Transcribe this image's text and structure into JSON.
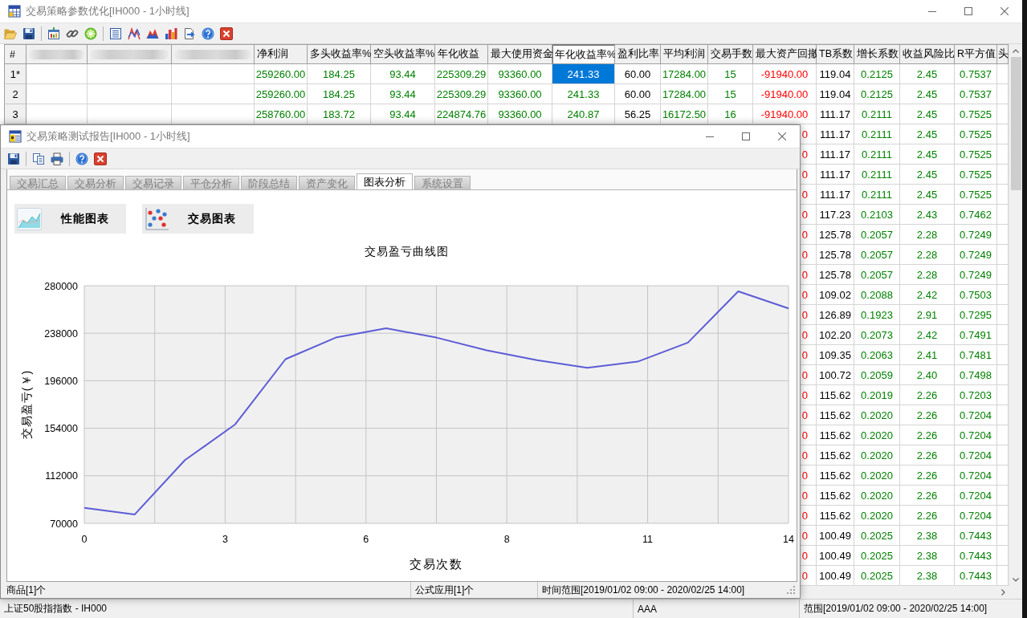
{
  "main_window": {
    "title": "交易策略参数优化[IH000 - 1小时线]",
    "table": {
      "row_header_label": "#",
      "columns": [
        {
          "redacted": true,
          "selected": false
        },
        {
          "redacted": true,
          "selected": false
        },
        {
          "redacted": true,
          "selected": false
        },
        {
          "label": "净利润",
          "color": "#008000",
          "selected": false
        },
        {
          "label": "多头收益率%",
          "color": "#008000",
          "selected": false
        },
        {
          "label": "空头收益率%",
          "color": "#008000",
          "selected": false
        },
        {
          "label": "年化收益",
          "color": "#008000",
          "selected": false
        },
        {
          "label": "最大使用资金",
          "color": "#008000",
          "selected": false
        },
        {
          "label": "年化收益率%",
          "color": "#008000",
          "selected": true
        },
        {
          "label": "盈利比率",
          "color": "#000000",
          "selected": false
        },
        {
          "label": "平均利润",
          "color": "#008000",
          "selected": false
        },
        {
          "label": "交易手数",
          "color": "#008000",
          "selected": false
        },
        {
          "label": "最大资产回撤",
          "color": "#ff0000",
          "selected": false
        },
        {
          "label": "TB系数",
          "color": "#000000",
          "selected": false
        },
        {
          "label": "增长系数",
          "color": "#008000",
          "selected": false
        },
        {
          "label": "收益风险比",
          "color": "#008000",
          "selected": false
        },
        {
          "label": "R平方值",
          "color": "#008000",
          "selected": false
        },
        {
          "label": "头",
          "selected": false
        }
      ],
      "rows": [
        {
          "header": "1*",
          "cells": [
            "",
            "",
            "",
            {
              "text": "259260.00",
              "selected": false
            },
            {
              "text": "184.25",
              "selected": false
            },
            {
              "text": "93.44",
              "selected": false
            },
            {
              "text": "225309.29",
              "selected": false
            },
            {
              "text": "93360.00",
              "selected": false
            },
            {
              "text": "241.33",
              "selected": true
            },
            {
              "text": "60.00",
              "selected": false
            },
            {
              "text": "17284.00",
              "selected": false
            },
            {
              "text": "15",
              "selected": false
            },
            {
              "text": "-91940.00",
              "selected": false
            },
            {
              "text": "119.04",
              "selected": false
            },
            {
              "text": "0.2125",
              "selected": false
            },
            {
              "text": "2.45",
              "selected": false
            },
            {
              "text": "0.7537",
              "selected": false
            }
          ]
        },
        {
          "header": "2",
          "cells": [
            "",
            "",
            "",
            {
              "text": "259260.00",
              "selected": false
            },
            {
              "text": "184.25",
              "selected": false
            },
            {
              "text": "93.44",
              "selected": false
            },
            {
              "text": "225309.29",
              "selected": false
            },
            {
              "text": "93360.00",
              "selected": false
            },
            {
              "text": "241.33",
              "selected": false
            },
            {
              "text": "60.00",
              "selected": false
            },
            {
              "text": "17284.00",
              "selected": false
            },
            {
              "text": "15",
              "selected": false
            },
            {
              "text": "-91940.00",
              "selected": false
            },
            {
              "text": "119.04",
              "selected": false
            },
            {
              "text": "0.2125",
              "selected": false
            },
            {
              "text": "2.45",
              "selected": false
            },
            {
              "text": "0.7537",
              "selected": false
            }
          ]
        },
        {
          "header": "3",
          "cells": [
            "",
            "",
            "",
            {
              "text": "258760.00",
              "selected": false
            },
            {
              "text": "183.72",
              "selected": false
            },
            {
              "text": "93.44",
              "selected": false
            },
            {
              "text": "224874.76",
              "selected": false
            },
            {
              "text": "93360.00",
              "selected": false
            },
            {
              "text": "240.87",
              "selected": false
            },
            {
              "text": "56.25",
              "selected": false
            },
            {
              "text": "16172.50",
              "selected": false
            },
            {
              "text": "16",
              "selected": false
            },
            {
              "text": "-91940.00",
              "selected": false
            },
            {
              "text": "111.17",
              "selected": false
            },
            {
              "text": "0.2111",
              "selected": false
            },
            {
              "text": "2.45",
              "selected": false
            },
            {
              "text": "0.7525",
              "selected": false
            }
          ]
        },
        {
          "cells": [
            "",
            "",
            "",
            "",
            "",
            "",
            "",
            "",
            "",
            "",
            "",
            "",
            {
              "text": "0",
              "selected": false
            },
            {
              "text": "111.17",
              "selected": false
            },
            {
              "text": "0.2111",
              "selected": false
            },
            {
              "text": "2.45",
              "selected": false
            },
            {
              "text": "0.7525",
              "selected": false
            }
          ]
        },
        {
          "cells": [
            "",
            "",
            "",
            "",
            "",
            "",
            "",
            "",
            "",
            "",
            "",
            "",
            {
              "text": "0",
              "selected": false
            },
            {
              "text": "111.17",
              "selected": false
            },
            {
              "text": "0.2111",
              "selected": false
            },
            {
              "text": "2.45",
              "selected": false
            },
            {
              "text": "0.7525",
              "selected": false
            }
          ]
        },
        {
          "cells": [
            "",
            "",
            "",
            "",
            "",
            "",
            "",
            "",
            "",
            "",
            "",
            "",
            {
              "text": "0",
              "selected": false
            },
            {
              "text": "111.17",
              "selected": false
            },
            {
              "text": "0.2111",
              "selected": false
            },
            {
              "text": "2.45",
              "selected": false
            },
            {
              "text": "0.7525",
              "selected": false
            }
          ]
        },
        {
          "cells": [
            "",
            "",
            "",
            "",
            "",
            "",
            "",
            "",
            "",
            "",
            "",
            "",
            {
              "text": "0",
              "selected": false
            },
            {
              "text": "111.17",
              "selected": false
            },
            {
              "text": "0.2111",
              "selected": false
            },
            {
              "text": "2.45",
              "selected": false
            },
            {
              "text": "0.7525",
              "selected": false
            }
          ]
        },
        {
          "cells": [
            "",
            "",
            "",
            "",
            "",
            "",
            "",
            "",
            "",
            "",
            "",
            "",
            {
              "text": "0",
              "selected": false
            },
            {
              "text": "117.23",
              "selected": false
            },
            {
              "text": "0.2103",
              "selected": false
            },
            {
              "text": "2.43",
              "selected": false
            },
            {
              "text": "0.7462",
              "selected": false
            }
          ]
        },
        {
          "cells": [
            "",
            "",
            "",
            "",
            "",
            "",
            "",
            "",
            "",
            "",
            "",
            "",
            {
              "text": "0",
              "selected": false
            },
            {
              "text": "125.78",
              "selected": false
            },
            {
              "text": "0.2057",
              "selected": false
            },
            {
              "text": "2.28",
              "selected": false
            },
            {
              "text": "0.7249",
              "selected": false
            }
          ]
        },
        {
          "cells": [
            "",
            "",
            "",
            "",
            "",
            "",
            "",
            "",
            "",
            "",
            "",
            "",
            {
              "text": "0",
              "selected": false
            },
            {
              "text": "125.78",
              "selected": false
            },
            {
              "text": "0.2057",
              "selected": false
            },
            {
              "text": "2.28",
              "selected": false
            },
            {
              "text": "0.7249",
              "selected": false
            }
          ]
        },
        {
          "cells": [
            "",
            "",
            "",
            "",
            "",
            "",
            "",
            "",
            "",
            "",
            "",
            "",
            {
              "text": "0",
              "selected": false
            },
            {
              "text": "125.78",
              "selected": false
            },
            {
              "text": "0.2057",
              "selected": false
            },
            {
              "text": "2.28",
              "selected": false
            },
            {
              "text": "0.7249",
              "selected": false
            }
          ]
        },
        {
          "cells": [
            "",
            "",
            "",
            "",
            "",
            "",
            "",
            "",
            "",
            "",
            "",
            "",
            {
              "text": "0",
              "selected": false
            },
            {
              "text": "109.02",
              "selected": false
            },
            {
              "text": "0.2088",
              "selected": false
            },
            {
              "text": "2.42",
              "selected": false
            },
            {
              "text": "0.7503",
              "selected": false
            }
          ]
        },
        {
          "cells": [
            "",
            "",
            "",
            "",
            "",
            "",
            "",
            "",
            "",
            "",
            "",
            "",
            {
              "text": "0",
              "selected": false
            },
            {
              "text": "126.89",
              "selected": false
            },
            {
              "text": "0.1923",
              "selected": false
            },
            {
              "text": "2.91",
              "selected": false
            },
            {
              "text": "0.7295",
              "selected": false
            }
          ]
        },
        {
          "cells": [
            "",
            "",
            "",
            "",
            "",
            "",
            "",
            "",
            "",
            "",
            "",
            "",
            {
              "text": "0",
              "selected": false
            },
            {
              "text": "102.20",
              "selected": false
            },
            {
              "text": "0.2073",
              "selected": false
            },
            {
              "text": "2.42",
              "selected": false
            },
            {
              "text": "0.7491",
              "selected": false
            }
          ]
        },
        {
          "cells": [
            "",
            "",
            "",
            "",
            "",
            "",
            "",
            "",
            "",
            "",
            "",
            "",
            {
              "text": "0",
              "selected": false
            },
            {
              "text": "109.35",
              "selected": false
            },
            {
              "text": "0.2063",
              "selected": false
            },
            {
              "text": "2.41",
              "selected": false
            },
            {
              "text": "0.7481",
              "selected": false
            }
          ]
        },
        {
          "cells": [
            "",
            "",
            "",
            "",
            "",
            "",
            "",
            "",
            "",
            "",
            "",
            "",
            {
              "text": "0",
              "selected": false
            },
            {
              "text": "100.72",
              "selected": false
            },
            {
              "text": "0.2059",
              "selected": false
            },
            {
              "text": "2.40",
              "selected": false
            },
            {
              "text": "0.7498",
              "selected": false
            }
          ]
        },
        {
          "cells": [
            "",
            "",
            "",
            "",
            "",
            "",
            "",
            "",
            "",
            "",
            "",
            "",
            {
              "text": "0",
              "selected": false
            },
            {
              "text": "115.62",
              "selected": false
            },
            {
              "text": "0.2019",
              "selected": false
            },
            {
              "text": "2.26",
              "selected": false
            },
            {
              "text": "0.7203",
              "selected": false
            }
          ]
        },
        {
          "cells": [
            "",
            "",
            "",
            "",
            "",
            "",
            "",
            "",
            "",
            "",
            "",
            "",
            {
              "text": "0",
              "selected": false
            },
            {
              "text": "115.62",
              "selected": false
            },
            {
              "text": "0.2020",
              "selected": false
            },
            {
              "text": "2.26",
              "selected": false
            },
            {
              "text": "0.7204",
              "selected": false
            }
          ]
        },
        {
          "cells": [
            "",
            "",
            "",
            "",
            "",
            "",
            "",
            "",
            "",
            "",
            "",
            "",
            {
              "text": "0",
              "selected": false
            },
            {
              "text": "115.62",
              "selected": false
            },
            {
              "text": "0.2020",
              "selected": false
            },
            {
              "text": "2.26",
              "selected": false
            },
            {
              "text": "0.7204",
              "selected": false
            }
          ]
        },
        {
          "cells": [
            "",
            "",
            "",
            "",
            "",
            "",
            "",
            "",
            "",
            "",
            "",
            "",
            {
              "text": "0",
              "selected": false
            },
            {
              "text": "115.62",
              "selected": false
            },
            {
              "text": "0.2020",
              "selected": false
            },
            {
              "text": "2.26",
              "selected": false
            },
            {
              "text": "0.7204",
              "selected": false
            }
          ]
        },
        {
          "cells": [
            "",
            "",
            "",
            "",
            "",
            "",
            "",
            "",
            "",
            "",
            "",
            "",
            {
              "text": "0",
              "selected": false
            },
            {
              "text": "115.62",
              "selected": false
            },
            {
              "text": "0.2020",
              "selected": false
            },
            {
              "text": "2.26",
              "selected": false
            },
            {
              "text": "0.7204",
              "selected": false
            }
          ]
        },
        {
          "cells": [
            "",
            "",
            "",
            "",
            "",
            "",
            "",
            "",
            "",
            "",
            "",
            "",
            {
              "text": "0",
              "selected": false
            },
            {
              "text": "115.62",
              "selected": false
            },
            {
              "text": "0.2020",
              "selected": false
            },
            {
              "text": "2.26",
              "selected": false
            },
            {
              "text": "0.7204",
              "selected": false
            }
          ]
        },
        {
          "cells": [
            "",
            "",
            "",
            "",
            "",
            "",
            "",
            "",
            "",
            "",
            "",
            "",
            {
              "text": "0",
              "selected": false
            },
            {
              "text": "115.62",
              "selected": false
            },
            {
              "text": "0.2020",
              "selected": false
            },
            {
              "text": "2.26",
              "selected": false
            },
            {
              "text": "0.7204",
              "selected": false
            }
          ]
        },
        {
          "cells": [
            "",
            "",
            "",
            "",
            "",
            "",
            "",
            "",
            "",
            "",
            "",
            "",
            {
              "text": "0",
              "selected": false
            },
            {
              "text": "100.49",
              "selected": false
            },
            {
              "text": "0.2025",
              "selected": false
            },
            {
              "text": "2.38",
              "selected": false
            },
            {
              "text": "0.7443",
              "selected": false
            }
          ]
        },
        {
          "cells": [
            "",
            "",
            "",
            "",
            "",
            "",
            "",
            "",
            "",
            "",
            "",
            "",
            {
              "text": "0",
              "selected": false
            },
            {
              "text": "100.49",
              "selected": false
            },
            {
              "text": "0.2025",
              "selected": false
            },
            {
              "text": "2.38",
              "selected": false
            },
            {
              "text": "0.7443",
              "selected": false
            }
          ]
        },
        {
          "cells": [
            "",
            "",
            "",
            "",
            "",
            "",
            "",
            "",
            "",
            "",
            "",
            "",
            {
              "text": "0",
              "selected": false
            },
            {
              "text": "100.49",
              "selected": false
            },
            {
              "text": "0.2025",
              "selected": false
            },
            {
              "text": "2.38",
              "selected": false
            },
            {
              "text": "0.7443",
              "selected": false
            }
          ]
        }
      ]
    },
    "status_bar": [
      "上证50股指指数 - IH000",
      "AAA",
      "范围[2019/01/02 09:00 - 2020/02/25 14:00]"
    ]
  },
  "report_window": {
    "title": "交易策略测试报告[IH000 - 1小时线]",
    "tabs": [
      {
        "label": "交易汇总",
        "selected": false
      },
      {
        "label": "交易分析",
        "selected": false
      },
      {
        "label": "交易记录",
        "selected": false
      },
      {
        "label": "平仓分析",
        "selected": false
      },
      {
        "label": "阶段总结",
        "selected": false
      },
      {
        "label": "资产变化",
        "selected": false
      },
      {
        "label": "图表分析",
        "selected": true
      },
      {
        "label": "系统设置",
        "selected": false
      }
    ],
    "chart_buttons": [
      {
        "label": "性能图表",
        "kind": "performance"
      },
      {
        "label": "交易图表",
        "kind": "trades"
      }
    ],
    "chart": {
      "chart_data": {
        "type": "line",
        "title": "交易盈亏曲线图",
        "xlabel": "交易次数",
        "ylabel": "交易盈亏(￥)",
        "x": [
          0,
          1,
          2,
          3,
          4,
          5,
          6,
          7,
          8,
          9,
          10,
          11,
          12,
          13,
          14
        ],
        "series": [
          {
            "color": "#5c5cd6",
            "values": [
              83600,
              77700,
              125800,
              157500,
              215100,
              234200,
              242400,
              234200,
              222900,
              214200,
              207400,
              212900,
              229700,
              275000,
              260000
            ]
          }
        ],
        "xlim": [
          0,
          14
        ],
        "ylim": [
          70000,
          280000
        ],
        "xticks": [
          0,
          {
            "value": 2.8,
            "label": "3"
          },
          {
            "value": 5.6,
            "label": "6"
          },
          {
            "value": 8.4,
            "label": "8"
          },
          {
            "value": 11.2,
            "label": "11"
          },
          14
        ],
        "yticks": [
          70000,
          112000,
          154000,
          196000,
          238000,
          280000
        ],
        "grid": true
      }
    },
    "status_bar": [
      "商品[1]个",
      "公式应用[1]个",
      "时间范围[2019/01/02 09:00 - 2020/02/25 14:00]"
    ]
  }
}
